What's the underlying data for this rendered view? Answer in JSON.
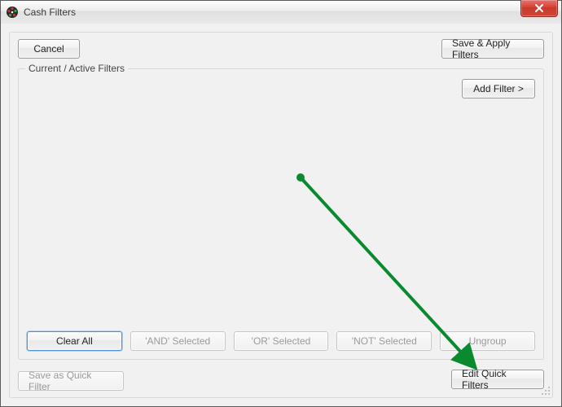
{
  "window": {
    "title": "Cash Filters"
  },
  "toolbar": {
    "cancel_label": "Cancel",
    "save_apply_label": "Save & Apply Filters"
  },
  "groupbox": {
    "label": "Current / Active Filters",
    "add_filter_label": "Add Filter >",
    "bottom_buttons": {
      "clear_all": "Clear All",
      "and_selected": "'AND' Selected",
      "or_selected": "'OR' Selected",
      "not_selected": "'NOT' Selected",
      "ungroup": "Ungroup"
    }
  },
  "footer": {
    "save_quick_label": "Save as Quick Filter",
    "edit_quick_label": "Edit Quick Filters"
  },
  "annotation": {
    "arrow_color": "#0a8a2f"
  }
}
